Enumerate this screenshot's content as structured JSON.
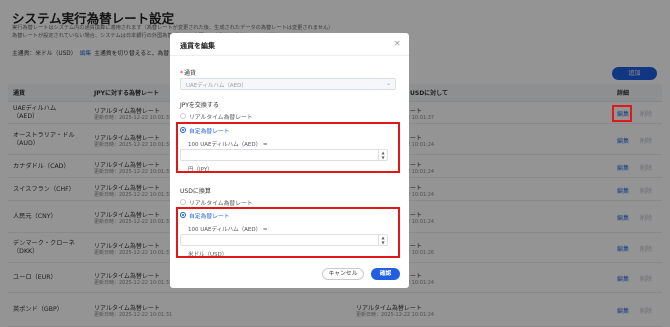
{
  "page": {
    "title": "システム実行為替レート設定",
    "desc1": "実行為替レートはシステム内の通貨換算に適用されます（為替レートが変更された後、生成されたデータの為替レートは変更されません）",
    "desc2": "為替レートが設定されていない場合、システムは日本銀行の外国為替データを参照して自動的に為替レートを計算します。",
    "main_currency_label": "主通貨：米ドル（USD）",
    "main_currency_edit": "編集",
    "main_currency_note": "主通貨を切り替えると、為替レートを再設定する必要があります",
    "add_button": "追加"
  },
  "table": {
    "headers": [
      "通貨",
      "JPYに対する為替レート",
      "USDに対して",
      "詳細"
    ],
    "rows": [
      {
        "currency": "UAEディルハム（AED）",
        "jpy_type": "リアルタイム為替レート",
        "jpy_updated": "更新日時：2025-12-22 10:01:31",
        "usd_type": "リアルタイム為替レート",
        "usd_updated": "更新日時：2025-12-22 10:01:37"
      },
      {
        "currency": "オーストラリア・ドル（AUD）",
        "jpy_type": "リアルタイム為替レート",
        "jpy_updated": "更新日時：2025-12-22 10:01:31",
        "usd_type": "リアルタイム為替レート",
        "usd_updated": "更新日時：2025-12-22 10:01:24"
      },
      {
        "currency": "カナダドル（CAD）",
        "jpy_type": "リアルタイム為替レート",
        "jpy_updated": "更新日時：2025-12-22 10:01:31",
        "usd_type": "リアルタイム為替レート",
        "usd_updated": "更新日時：2025-12-22 10:01:24"
      },
      {
        "currency": "スイスフラン（CHF）",
        "jpy_type": "リアルタイム為替レート",
        "jpy_updated": "更新日時：2025-12-22 10:01:31",
        "usd_type": "リアルタイム為替レート",
        "usd_updated": "更新日時：2025-12-22 10:01:24"
      },
      {
        "currency": "人民元（CNY）",
        "jpy_type": "リアルタイム為替レート",
        "jpy_updated": "更新日時：2025-12-22 10:01:31",
        "usd_type": "リアルタイム為替レート",
        "usd_updated": "更新日時：2025-12-22 10:01:24"
      },
      {
        "currency": "デンマーク・クローネ（DKK）",
        "jpy_type": "リアルタイム為替レート",
        "jpy_updated": "更新日時：2025-12-22 10:01:31",
        "usd_type": "リアルタイム為替レート",
        "usd_updated": "更新日時：2025-12-22 10:01:26"
      },
      {
        "currency": "ユーロ（EUR）",
        "jpy_type": "リアルタイム為替レート",
        "jpy_updated": "更新日時：2025-12-22 10:01:31",
        "usd_type": "リアルタイム為替レート",
        "usd_updated": "更新日時：2025-12-22 10:01:24"
      },
      {
        "currency": "英ポンド（GBP）",
        "jpy_type": "リアルタイム為替レート",
        "jpy_updated": "更新日時：2025-12-22 10:01:31",
        "usd_type": "リアルタイム為替レート",
        "usd_updated": "更新日時：2025-12-22 10:01:24"
      }
    ],
    "edit_label": "編集",
    "delete_label": "削除"
  },
  "modal": {
    "title": "通貨を編集",
    "close_icon": "close-icon",
    "currency_label": "通貨",
    "currency_value": "UAEディルハム（AED）",
    "jpy_section_label": "JPYを交換する",
    "usd_section_label": "USDに換算",
    "radio_realtime": "リアルタイム為替レート",
    "radio_custom": "自定為替レート",
    "jpy_rate_prefix": "100 UAEディルハム（AED） =",
    "jpy_rate_value": "",
    "jpy_unit": "円（JPY）",
    "usd_rate_prefix": "100 UAEディルハム（AED） =",
    "usd_rate_value": "",
    "usd_unit": "米ドル（USD）",
    "cancel_button": "キャンセル",
    "ok_button": "確認"
  },
  "colors": {
    "accent": "#1f5fe0",
    "highlight": "#e01818"
  }
}
